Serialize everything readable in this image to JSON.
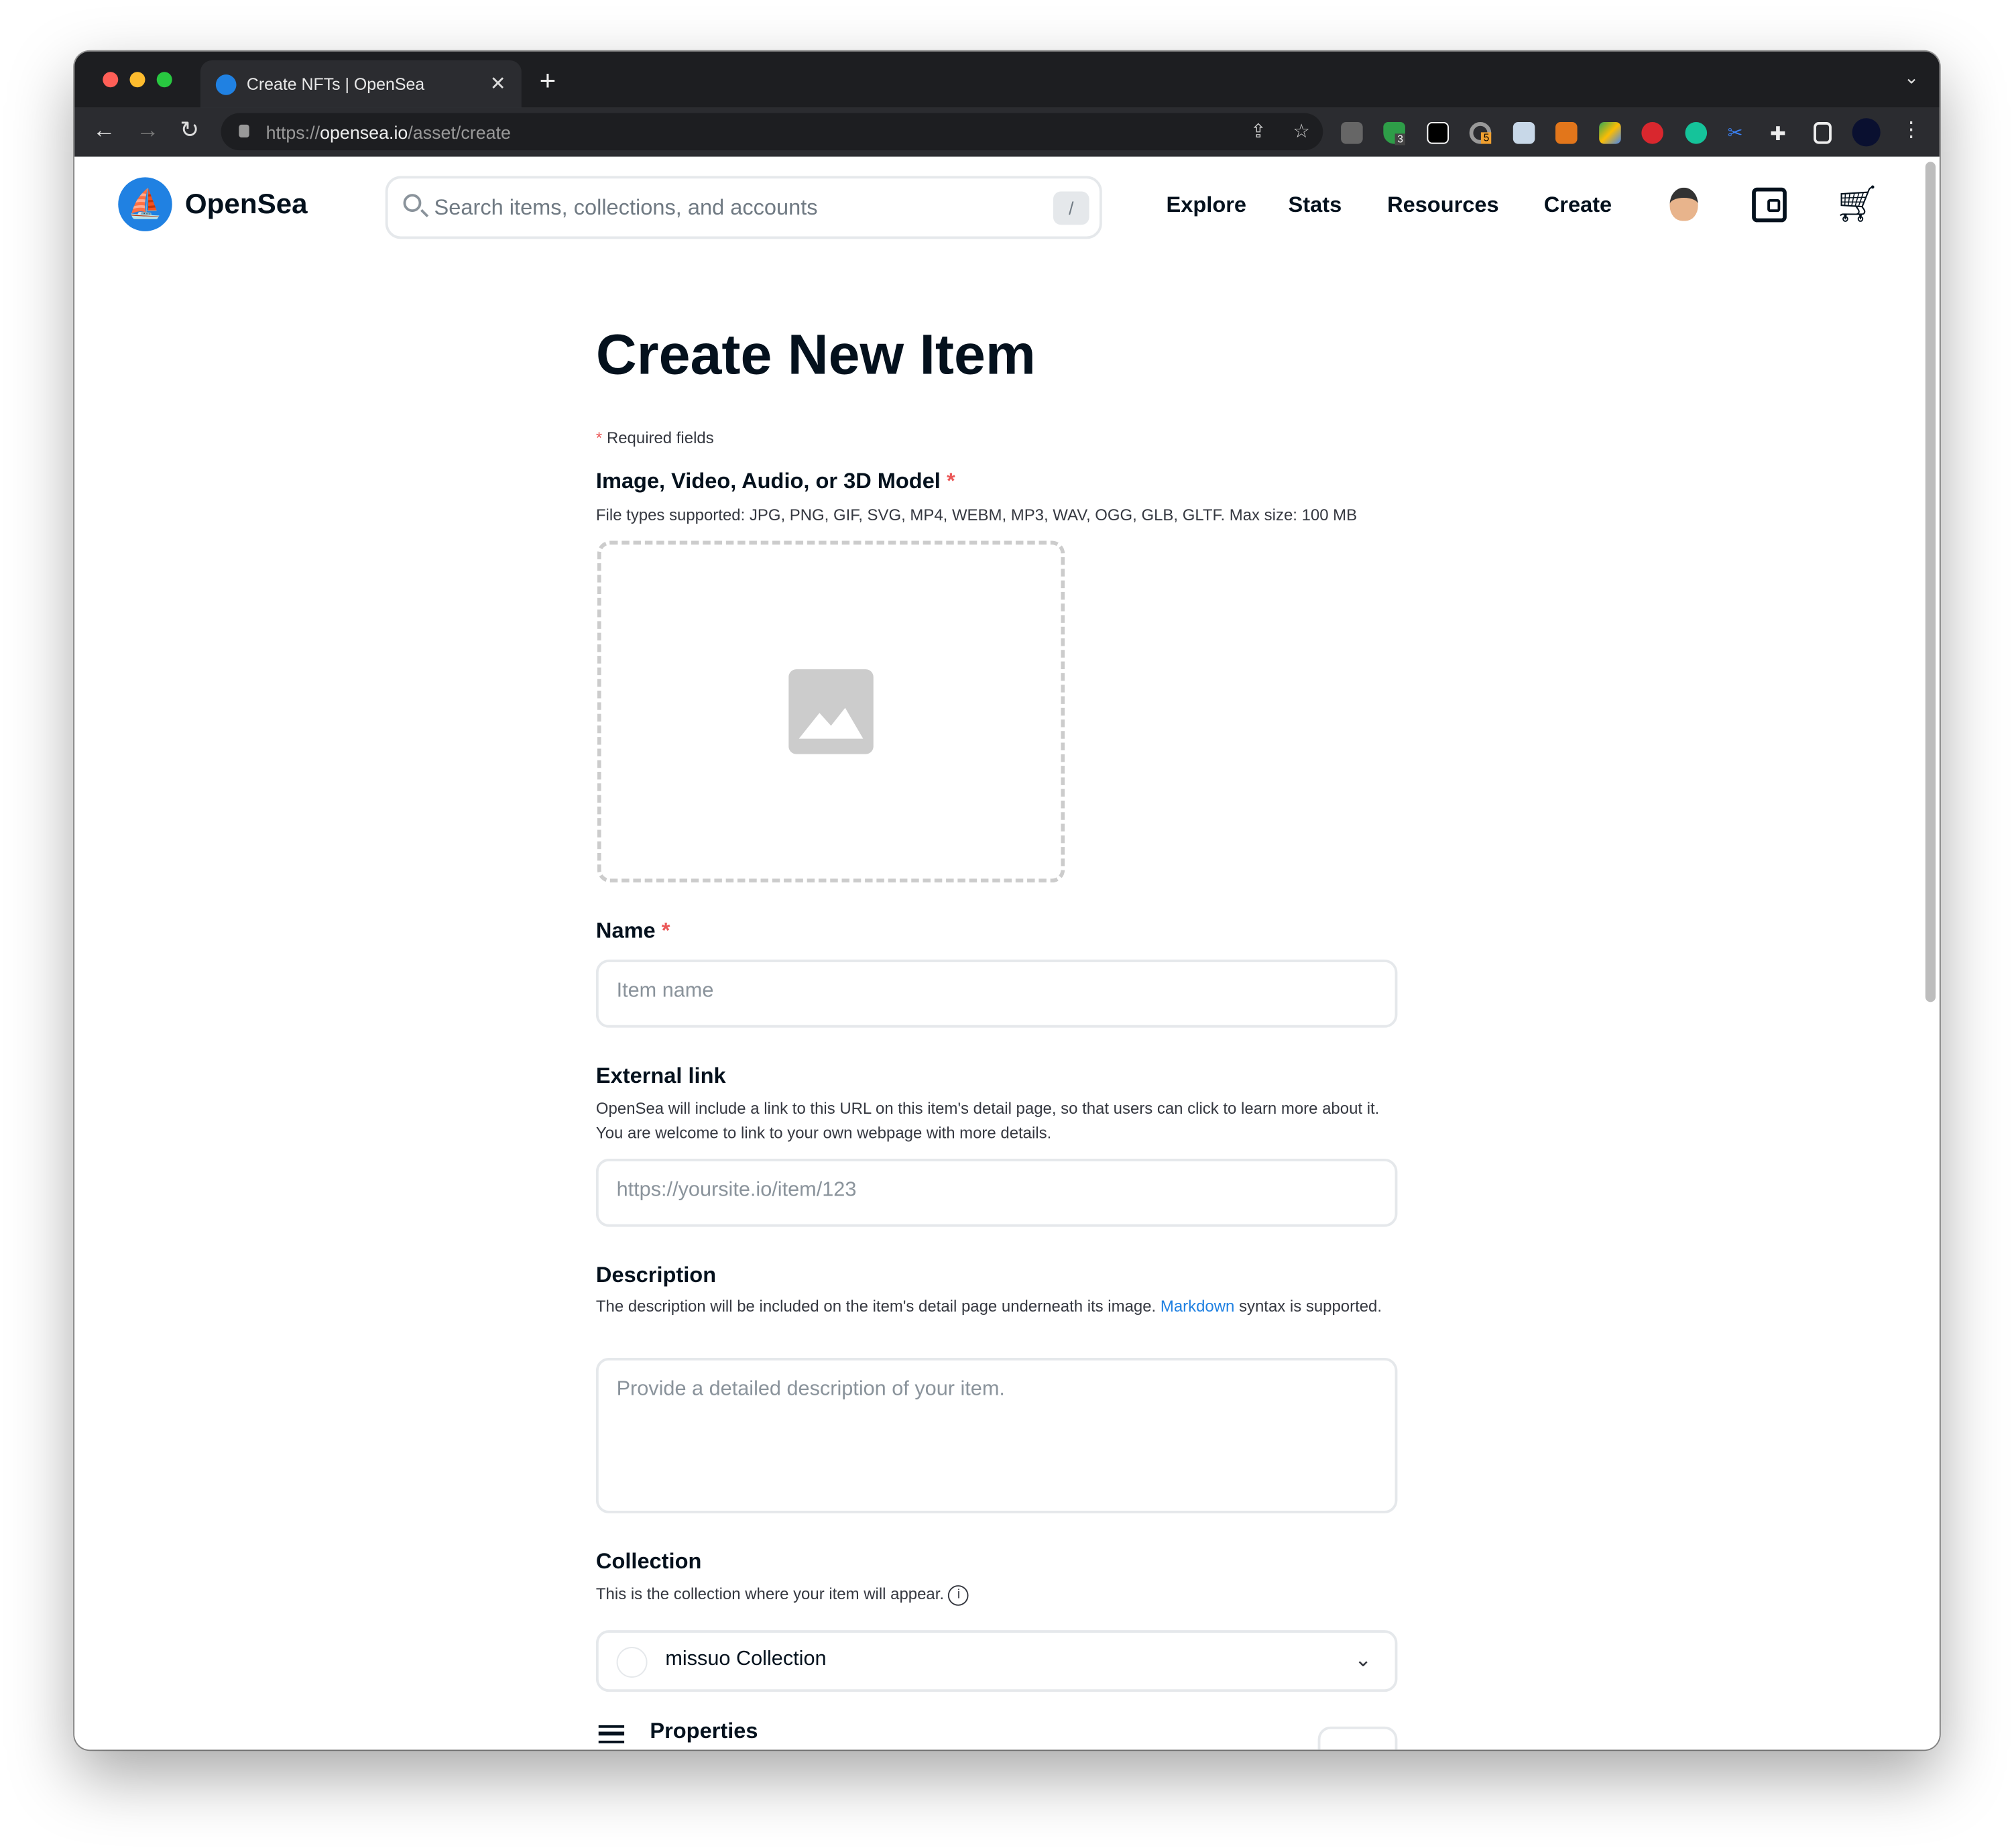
{
  "browser": {
    "tab_title": "Create NFTs | OpenSea",
    "url_scheme": "https://",
    "url_host": "opensea.io",
    "url_path": "/asset/create",
    "extension_badges": [
      "3",
      "5"
    ],
    "colors": {
      "close": "#ff5f57",
      "minimize": "#febc2e",
      "maximize": "#28c840"
    }
  },
  "header": {
    "brand": "OpenSea",
    "search_placeholder": "Search items, collections, and accounts",
    "search_shortcut": "/",
    "nav": [
      "Explore",
      "Stats",
      "Resources",
      "Create"
    ],
    "accent": "#2081e2"
  },
  "form": {
    "title": "Create New Item",
    "required_star": "*",
    "required_note": "Required fields",
    "media_label": "Image, Video, Audio, or 3D Model",
    "media_hint": "File types supported: JPG, PNG, GIF, SVG, MP4, WEBM, MP3, WAV, OGG, GLB, GLTF. Max size: 100 MB",
    "name_label": "Name",
    "name_placeholder": "Item name",
    "link_label": "External link",
    "link_hint": "OpenSea will include a link to this URL on this item's detail page, so that users can click to learn more about it. You are welcome to link to your own webpage with more details.",
    "link_placeholder": "https://yoursite.io/item/123",
    "desc_label": "Description",
    "desc_hint_pre": "The description will be included on the item's detail page underneath its image.",
    "desc_hint_link": "Markdown",
    "desc_hint_post": "syntax is supported.",
    "desc_placeholder": "Provide a detailed description of your item.",
    "collection_label": "Collection",
    "collection_hint": "This is the collection where your item will appear.",
    "collection_value": "missuo Collection",
    "properties_label": "Properties"
  }
}
